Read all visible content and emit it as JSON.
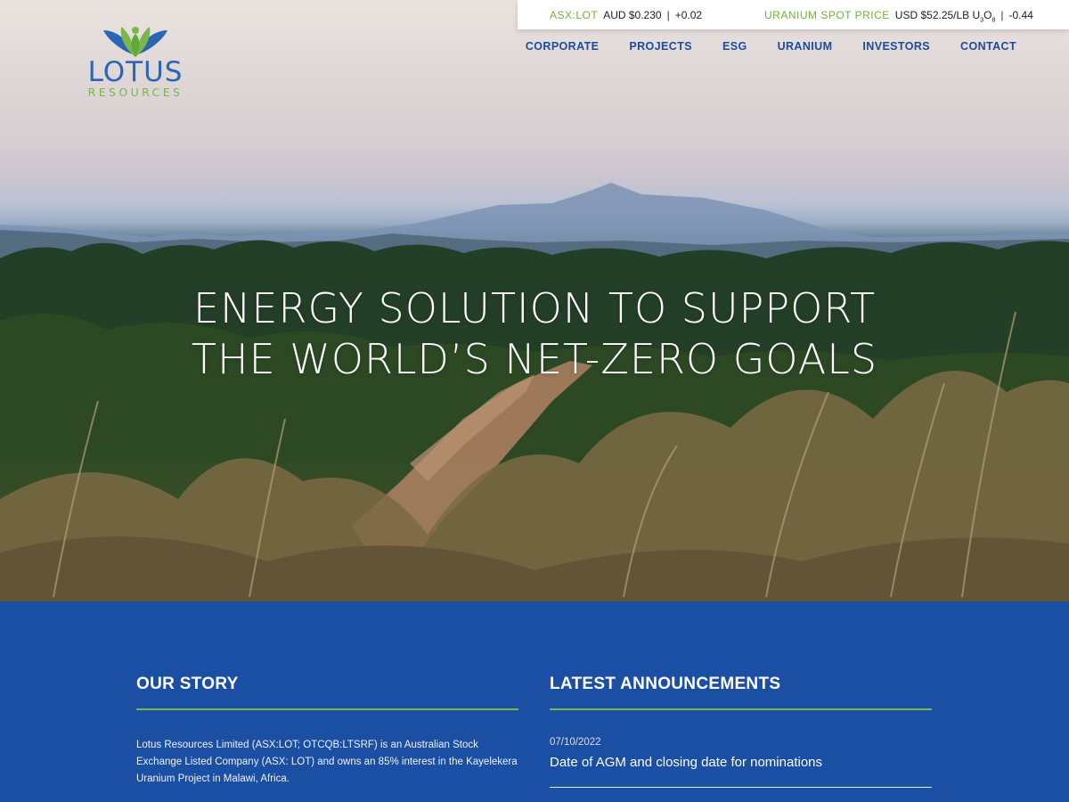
{
  "logo": {
    "word": "LOTUS",
    "sub": "RESOURCES"
  },
  "ticker": {
    "asx_label": "ASX:LOT",
    "asx_price": "AUD $0.230",
    "asx_change": "+0.02",
    "uranium_label": "URANIUM SPOT PRICE",
    "uranium_price": "USD $52.25/LB U",
    "uranium_sub1": "3",
    "uranium_o": "O",
    "uranium_sub2": "8",
    "uranium_change": "-0.44"
  },
  "nav": {
    "items": [
      {
        "label": "CORPORATE"
      },
      {
        "label": "PROJECTS"
      },
      {
        "label": "ESG"
      },
      {
        "label": "URANIUM"
      },
      {
        "label": "INVESTORS"
      },
      {
        "label": "CONTACT"
      }
    ]
  },
  "hero": {
    "line1": "ENERGY SOLUTION TO SUPPORT",
    "line2": "THE WORLD’S NET-ZERO GOALS"
  },
  "story": {
    "heading": "OUR STORY",
    "text": "Lotus Resources Limited (ASX:LOT; OTCQB:LTSRF) is an Australian Stock Exchange Listed Company (ASX: LOT) and owns an 85% interest in the Kayelekera Uranium Project  in Malawi, Africa."
  },
  "announcements": {
    "heading": "LATEST ANNOUNCEMENTS",
    "items": [
      {
        "date": "07/10/2022",
        "title": "Date of AGM and closing date for nominations"
      }
    ]
  },
  "colors": {
    "brand_blue": "#1a4fa3",
    "accent_green": "#7ab648",
    "nav_blue": "#1b4c9c"
  }
}
